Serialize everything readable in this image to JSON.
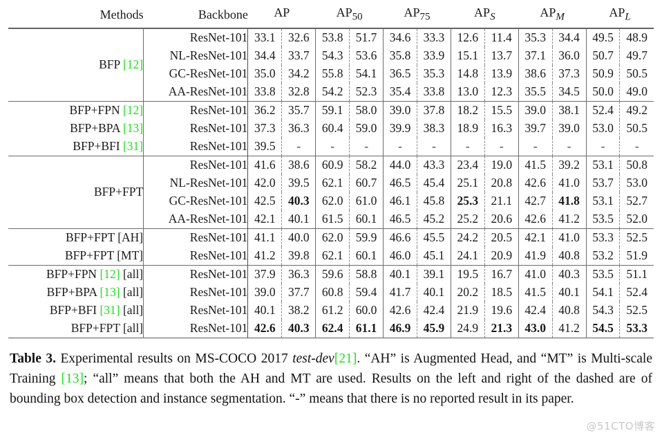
{
  "table": {
    "columns": {
      "methods": "Methods",
      "backbone": "Backbone",
      "metrics": [
        "AP",
        "AP50",
        "AP75",
        "APS",
        "APM",
        "APL"
      ],
      "metric_labels": [
        {
          "base": "AP",
          "sub": ""
        },
        {
          "base": "AP",
          "sub": "50"
        },
        {
          "base": "AP",
          "sub": "75"
        },
        {
          "base": "AP",
          "sub": "S"
        },
        {
          "base": "AP",
          "sub": "M"
        },
        {
          "base": "AP",
          "sub": "L"
        }
      ]
    },
    "groups": [
      {
        "label": "BFP",
        "cite": "[12]",
        "suffix": "",
        "rows": [
          {
            "backbone": "ResNet-101",
            "values": [
              "33.1",
              "32.6",
              "53.8",
              "51.7",
              "34.6",
              "33.3",
              "12.6",
              "11.4",
              "35.3",
              "34.4",
              "49.5",
              "48.9"
            ],
            "bold": [
              false,
              false,
              false,
              false,
              false,
              false,
              false,
              false,
              false,
              false,
              false,
              false
            ]
          },
          {
            "backbone": "NL-ResNet-101",
            "values": [
              "34.4",
              "33.7",
              "54.3",
              "53.6",
              "35.8",
              "33.9",
              "15.1",
              "13.7",
              "37.1",
              "36.0",
              "50.7",
              "49.7"
            ],
            "bold": [
              false,
              false,
              false,
              false,
              false,
              false,
              false,
              false,
              false,
              false,
              false,
              false
            ]
          },
          {
            "backbone": "GC-ResNet-101",
            "values": [
              "35.0",
              "34.2",
              "55.8",
              "54.1",
              "36.5",
              "35.3",
              "14.8",
              "13.9",
              "38.6",
              "37.3",
              "50.9",
              "50.5"
            ],
            "bold": [
              false,
              false,
              false,
              false,
              false,
              false,
              false,
              false,
              false,
              false,
              false,
              false
            ]
          },
          {
            "backbone": "AA-ResNet-101",
            "values": [
              "33.8",
              "32.8",
              "54.2",
              "52.3",
              "35.4",
              "33.8",
              "13.0",
              "12.3",
              "35.5",
              "34.5",
              "50.0",
              "49.0"
            ],
            "bold": [
              false,
              false,
              false,
              false,
              false,
              false,
              false,
              false,
              false,
              false,
              false,
              false
            ]
          }
        ]
      },
      {
        "label": null,
        "rows": [
          {
            "method": "BFP+FPN",
            "cite": "[12]",
            "suffix": "",
            "backbone": "ResNet-101",
            "values": [
              "36.2",
              "35.7",
              "59.1",
              "58.0",
              "39.0",
              "37.8",
              "18.2",
              "15.5",
              "39.0",
              "38.1",
              "52.4",
              "49.2"
            ],
            "bold": [
              false,
              false,
              false,
              false,
              false,
              false,
              false,
              false,
              false,
              false,
              false,
              false
            ]
          },
          {
            "method": "BFP+BPA",
            "cite": "[13]",
            "suffix": "",
            "backbone": "ResNet-101",
            "values": [
              "37.3",
              "36.3",
              "60.4",
              "59.0",
              "39.9",
              "38.3",
              "18.9",
              "16.3",
              "39.7",
              "39.0",
              "53.0",
              "50.5"
            ],
            "bold": [
              false,
              false,
              false,
              false,
              false,
              false,
              false,
              false,
              false,
              false,
              false,
              false
            ]
          },
          {
            "method": "BFP+BFI",
            "cite": "[31]",
            "suffix": "",
            "backbone": "ResNet-101",
            "values": [
              "39.5",
              "-",
              "-",
              "-",
              "-",
              "-",
              "-",
              "-",
              "-",
              "-",
              "-",
              "-"
            ],
            "bold": [
              false,
              false,
              false,
              false,
              false,
              false,
              false,
              false,
              false,
              false,
              false,
              false
            ]
          }
        ]
      },
      {
        "label": "BFP+FPT",
        "cite": "",
        "suffix": "",
        "rows": [
          {
            "backbone": "ResNet-101",
            "values": [
              "41.6",
              "38.6",
              "60.9",
              "58.2",
              "44.0",
              "43.3",
              "23.4",
              "19.0",
              "41.5",
              "39.2",
              "53.1",
              "50.8"
            ],
            "bold": [
              false,
              false,
              false,
              false,
              false,
              false,
              false,
              false,
              false,
              false,
              false,
              false
            ]
          },
          {
            "backbone": "NL-ResNet-101",
            "values": [
              "42.0",
              "39.5",
              "62.1",
              "60.7",
              "46.5",
              "45.4",
              "25.1",
              "20.8",
              "42.6",
              "41.0",
              "53.7",
              "53.0"
            ],
            "bold": [
              false,
              false,
              false,
              false,
              false,
              false,
              false,
              false,
              false,
              false,
              false,
              false
            ]
          },
          {
            "backbone": "GC-ResNet-101",
            "values": [
              "42.5",
              "40.3",
              "62.0",
              "61.0",
              "46.1",
              "45.8",
              "25.3",
              "21.1",
              "42.7",
              "41.8",
              "53.1",
              "52.7"
            ],
            "bold": [
              false,
              true,
              false,
              false,
              false,
              false,
              true,
              false,
              false,
              true,
              false,
              false
            ]
          },
          {
            "backbone": "AA-ResNet-101",
            "values": [
              "42.1",
              "40.1",
              "61.5",
              "60.1",
              "46.5",
              "45.2",
              "25.2",
              "20.6",
              "42.6",
              "41.2",
              "53.5",
              "52.0"
            ],
            "bold": [
              false,
              false,
              false,
              false,
              false,
              false,
              false,
              false,
              false,
              false,
              false,
              false
            ]
          }
        ]
      },
      {
        "label": null,
        "rows": [
          {
            "method": "BFP+FPT",
            "cite": "",
            "suffix": "[AH]",
            "backbone": "ResNet-101",
            "values": [
              "41.1",
              "40.0",
              "62.0",
              "59.9",
              "46.6",
              "45.5",
              "24.2",
              "20.5",
              "42.1",
              "41.0",
              "53.3",
              "52.5"
            ],
            "bold": [
              false,
              false,
              false,
              false,
              false,
              false,
              false,
              false,
              false,
              false,
              false,
              false
            ]
          },
          {
            "method": "BFP+FPT",
            "cite": "",
            "suffix": "[MT]",
            "backbone": "ResNet-101",
            "values": [
              "41.2",
              "39.8",
              "62.1",
              "60.1",
              "46.0",
              "45.1",
              "24.1",
              "20.9",
              "41.9",
              "40.8",
              "53.2",
              "51.9"
            ],
            "bold": [
              false,
              false,
              false,
              false,
              false,
              false,
              false,
              false,
              false,
              false,
              false,
              false
            ]
          }
        ]
      },
      {
        "label": null,
        "rows": [
          {
            "method": "BFP+FPN",
            "cite": "[12]",
            "suffix": "[all]",
            "backbone": "ResNet-101",
            "values": [
              "37.9",
              "36.3",
              "59.6",
              "58.8",
              "40.1",
              "39.1",
              "19.5",
              "16.7",
              "41.0",
              "40.3",
              "53.5",
              "51.1"
            ],
            "bold": [
              false,
              false,
              false,
              false,
              false,
              false,
              false,
              false,
              false,
              false,
              false,
              false
            ]
          },
          {
            "method": "BFP+BPA",
            "cite": "[13]",
            "suffix": "[all]",
            "backbone": "ResNet-101",
            "values": [
              "39.0",
              "37.7",
              "60.8",
              "59.4",
              "41.7",
              "40.1",
              "20.2",
              "18.5",
              "41.5",
              "40.1",
              "54.1",
              "52.4"
            ],
            "bold": [
              false,
              false,
              false,
              false,
              false,
              false,
              false,
              false,
              false,
              false,
              false,
              false
            ]
          },
          {
            "method": "BFP+BFI",
            "cite": "[31]",
            "suffix": "[all]",
            "backbone": "ResNet-101",
            "values": [
              "40.1",
              "38.2",
              "61.2",
              "60.0",
              "42.6",
              "42.4",
              "21.9",
              "19.6",
              "42.4",
              "40.8",
              "54.3",
              "52.5"
            ],
            "bold": [
              false,
              false,
              false,
              false,
              false,
              false,
              false,
              false,
              false,
              false,
              false,
              false
            ]
          },
          {
            "method": "BFP+FPT",
            "cite": "",
            "suffix": "[all]",
            "backbone": "ResNet-101",
            "values": [
              "42.6",
              "40.3",
              "62.4",
              "61.1",
              "46.9",
              "45.9",
              "24.9",
              "21.3",
              "43.0",
              "41.2",
              "54.5",
              "53.3"
            ],
            "bold": [
              true,
              true,
              true,
              true,
              true,
              true,
              false,
              true,
              true,
              false,
              true,
              true
            ]
          }
        ]
      }
    ]
  },
  "caption": {
    "label": "Table 3.",
    "part1": " Experimental results on MS-COCO 2017 ",
    "italic1": "test-dev",
    "cite1": "[21]",
    "part2": ". “AH” is Augmented Head, and “MT” is Multi-scale Training ",
    "cite2": "[13]",
    "part3": "; “all” means that both the AH and MT are used. Results on the left and right of the dashed are of bounding box detection and instance segmentation. “-” means that there is no reported result in its paper."
  },
  "watermark": "@51CTO博客",
  "colors": {
    "citation_green": "#22dd22",
    "rule": "#5a5a5a",
    "text": "#1a1a1a",
    "watermark": "#c9c9c9"
  }
}
